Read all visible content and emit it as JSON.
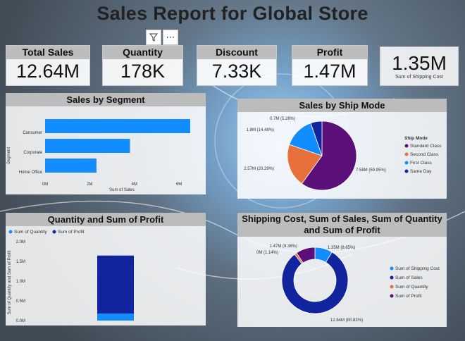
{
  "report": {
    "title": "Sales Report for Global Store"
  },
  "toolbar": {
    "filter_icon": "filter-icon",
    "more_icon": "more-options-icon"
  },
  "kpis": [
    {
      "label": "Total Sales",
      "value": "12.64M"
    },
    {
      "label": "Quantity",
      "value": "178K"
    },
    {
      "label": "Discount",
      "value": "7.33K"
    },
    {
      "label": "Profit",
      "value": "1.47M"
    }
  ],
  "shipping_kpi": {
    "value": "1.35M",
    "label": "Sum of Shipping Cost"
  },
  "colors": {
    "purple": "#5b0f78",
    "orange": "#e8703a",
    "blue": "#118dff",
    "navy": "#12239e",
    "header": "#bcbcbc"
  },
  "chart_data": [
    {
      "type": "bar",
      "title": "Sales by Segment",
      "orientation": "horizontal",
      "categories": [
        "Consumer",
        "Corporate",
        "Home Office"
      ],
      "values": [
        6.5,
        3.8,
        2.3
      ],
      "xlabel": "Sum of Sales",
      "ylabel": "Segment",
      "xticks": [
        "0M",
        "2M",
        "4M",
        "6M"
      ],
      "xlim": [
        0,
        6.5
      ],
      "color": "#118dff"
    },
    {
      "type": "pie",
      "title": "Sales by Ship Mode",
      "legend_title": "Ship Mode",
      "legend_position": "right",
      "slices": [
        {
          "name": "Standard Class",
          "value": 7.58,
          "label": "7.58M (59.95%)",
          "color": "#5b0f78"
        },
        {
          "name": "Second Class",
          "value": 2.57,
          "label": "2.57M (20.29%)",
          "color": "#e8703a"
        },
        {
          "name": "First Class",
          "value": 1.83,
          "label": "1.8M (14.48%)",
          "color": "#118dff"
        },
        {
          "name": "Same Day",
          "value": 0.67,
          "label": "0.7M (5.28%)",
          "color": "#12239e"
        }
      ]
    },
    {
      "type": "bar",
      "title": "Quantity and Sum of Profit",
      "stacked": true,
      "legend_position": "top-left",
      "series": [
        {
          "name": "Sum of Quantity",
          "values": [
            0.178
          ],
          "color": "#118dff"
        },
        {
          "name": "Sum of Profit",
          "values": [
            1.47
          ],
          "color": "#12239e"
        }
      ],
      "ylabel": "Sum of Quantity and Sum of Profit",
      "yticks": [
        "0.0M",
        "0.5M",
        "1.0M",
        "1.5M",
        "2.0M"
      ],
      "ylim": [
        0,
        2.0
      ]
    },
    {
      "type": "pie",
      "donut": true,
      "title": "Shipping Cost, Sum of Sales, Sum of Quantity and Sum of Profit",
      "legend_position": "right",
      "slices": [
        {
          "name": "Sum of Shipping Cost",
          "value": 1.35,
          "label": "1.35M (8.65%)",
          "color": "#118dff"
        },
        {
          "name": "Sum of Sales",
          "value": 12.64,
          "label": "12.64M (80.83%)",
          "color": "#12239e"
        },
        {
          "name": "Sum of Quantity",
          "value": 0.18,
          "label": "0M (1.14%)",
          "color": "#e8703a"
        },
        {
          "name": "Sum of Profit",
          "value": 1.47,
          "label": "1.47M (9.38%)",
          "color": "#5b0f78"
        }
      ]
    }
  ]
}
